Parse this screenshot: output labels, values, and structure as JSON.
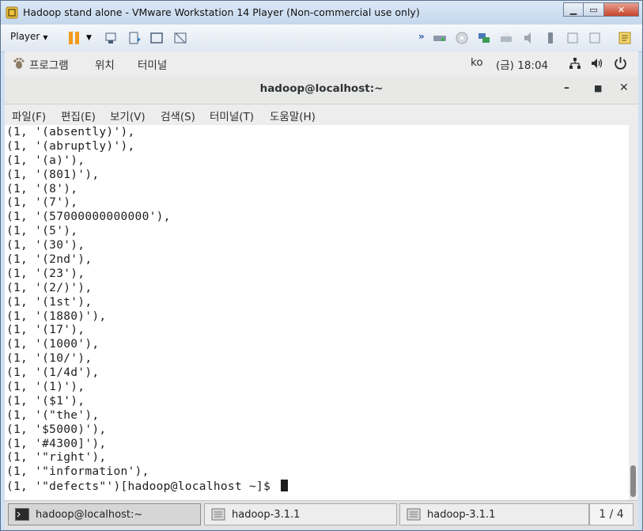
{
  "vmware": {
    "window_title": "Hadoop stand alone - VMware Workstation 14 Player (Non-commercial use only)",
    "player_menu": "Player"
  },
  "gnome": {
    "applications": "프로그램",
    "places": "위치",
    "terminal_app": "터미널",
    "input_method": "ko",
    "clock": "(금) 18:04"
  },
  "terminal": {
    "title": "hadoop@localhost:~",
    "menu": [
      "파일(F)",
      "편집(E)",
      "보기(V)",
      "검색(S)",
      "터미널(T)",
      "도움말(H)"
    ],
    "lines": [
      "(1, '(absently)'),",
      "(1, '(abruptly)'),",
      "(1, '(a)'),",
      "(1, '(801)'),",
      "(1, '(8'),",
      "(1, '(7'),",
      "(1, '(57000000000000'),",
      "(1, '(5'),",
      "(1, '(30'),",
      "(1, '(2nd'),",
      "(1, '(23'),",
      "(1, '(2/)'),",
      "(1, '(1st'),",
      "(1, '(1880)'),",
      "(1, '(17'),",
      "(1, '(1000'),",
      "(1, '(10/'),",
      "(1, '(1/4d'),",
      "(1, '(1)'),",
      "(1, '($1'),",
      "(1, '(\"the'),",
      "(1, '$5000)'),",
      "(1, '#4300]'),",
      "(1, '\"right'),",
      "(1, '\"information'),",
      "(1, '\"defects\"')[hadoop@localhost ~]$ "
    ]
  },
  "taskbar": {
    "tasks": [
      "hadoop@localhost:~",
      "hadoop-3.1.1",
      "hadoop-3.1.1"
    ],
    "workspace": "1 / 4"
  },
  "icons": {
    "vm-title": "vmware-icon",
    "pause": "pause-icon",
    "gnome-apps": "gnome-foot-icon",
    "network": "network-icon",
    "volume": "volume-icon",
    "power": "power-icon"
  },
  "colors": {
    "terminal_bg": "#ffffff",
    "terminal_fg": "#1e1e1e",
    "pause_orange": "#f29b1d"
  }
}
